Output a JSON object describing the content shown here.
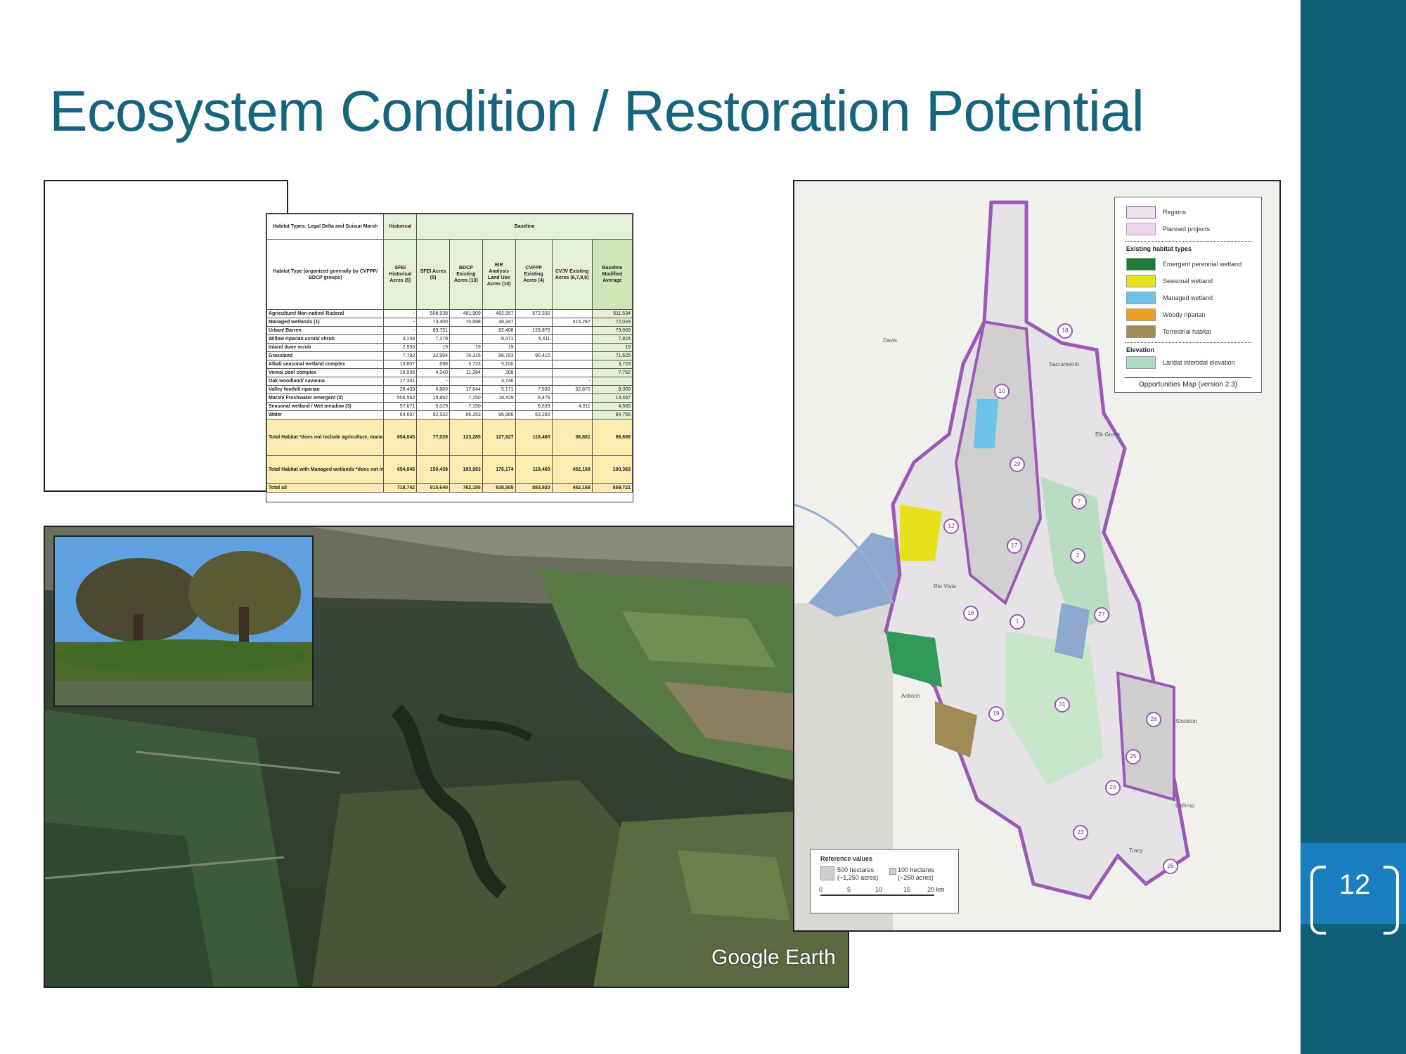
{
  "slide": {
    "title": "Ecosystem Condition / Restoration Potential",
    "page_number": "12",
    "accent_color": "#0e5f78",
    "title_color": "#16657f"
  },
  "habitat_table": {
    "title": "Habitat Types: Legal Delta and Suisun Marsh",
    "group_historical": "Historical",
    "group_baseline": "Baseline",
    "columns": [
      "Habitat Type (organized generally by CVFPP/ BDCP groups)",
      "SFEI Historical Acres (5)",
      "SFEI Acres (5)",
      "BDCP Existing Acres (13)",
      "EIR Analysis Land Use Acres (10)",
      "CVFPP Existing Acres (4)",
      "CVJV Existing Acres (6,7,8,9)",
      "Baseline Modified Average"
    ],
    "rows": [
      [
        "Agriculture/ Non-native/ Ruderal",
        "-",
        "508,938",
        "481,909",
        "482,957",
        "572,330",
        "",
        "511,534"
      ],
      [
        "Managed wetlands (1)",
        "-",
        "73,400",
        "70,698",
        "48,347",
        "",
        "415,287",
        "72,049"
      ],
      [
        "Urban/ Barren",
        "-",
        "63,731",
        "",
        "82,408",
        "129,870",
        "",
        "73,069"
      ],
      [
        "Willow riparian scrub/ shrub",
        "3,158",
        "7,278",
        "",
        "8,371",
        "5,411",
        "",
        "7,824"
      ],
      [
        "Inland dune scrub",
        "2,550",
        "19",
        "19",
        "19",
        "",
        "",
        "19"
      ],
      [
        "Grassland",
        "7,792",
        "32,994",
        "76,315",
        "86,783",
        "90,410",
        "",
        "71,625"
      ],
      [
        "Alkali seasonal wetland complex",
        "13,607",
        "698",
        "3,723",
        "5,100",
        "",
        "",
        "3,723"
      ],
      [
        "Vernal pool complex",
        "16,935",
        "4,240",
        "11,284",
        "208",
        "",
        "",
        "7,762"
      ],
      [
        "Oak woodland/ savanna",
        "17,331",
        "-",
        "",
        "3,746",
        "",
        "-",
        ""
      ],
      [
        "Valley foothill riparian",
        "28,439",
        "6,889",
        "17,644",
        "5,171",
        "7,530",
        "32,870",
        "9,309"
      ],
      [
        "Marsh/ Freshwater emergent (2)",
        "506,562",
        "19,892",
        "7,150",
        "18,429",
        "8,476",
        "",
        "13,487"
      ],
      [
        "Seasonal wetland / Wet meadow (3)",
        "57,671",
        "5,029",
        "7,150",
        "-",
        "6,633",
        "4,011",
        "4,565"
      ],
      [
        "Water",
        "64,697",
        "92,532",
        "86,263",
        "96,966",
        "63,260",
        "",
        "84,755"
      ]
    ],
    "total_habitat": [
      "Total Habitat *does not include agriculture, managed wetlands, urban/barren, water",
      "654,045",
      "77,039",
      "123,285",
      "127,827",
      "118,460",
      "36,881",
      "96,698"
    ],
    "total_with_managed": [
      "Total Habitat with Managed wetlands *does not include agriculture, urban/barren, water",
      "654,045",
      "150,439",
      "193,983",
      "176,174",
      "118,460",
      "452,168",
      "190,363"
    ],
    "total_all": [
      "Total all",
      "718,742",
      "815,640",
      "762,155",
      "838,505",
      "883,920",
      "452,168",
      "859,721"
    ]
  },
  "aerial": {
    "watermark": "Google Earth"
  },
  "map": {
    "legend": {
      "items": [
        {
          "label": "Regions",
          "color": "#e8e2ea"
        },
        {
          "label": "Planned projects",
          "color": "#edd3ec"
        }
      ],
      "habitat_header": "Existing habitat types",
      "habitats": [
        {
          "label": "Emergent perennial wetland",
          "color": "#1f7a3a"
        },
        {
          "label": "Seasonal wetland",
          "color": "#e8e21a"
        },
        {
          "label": "Managed wetland",
          "color": "#6cc2e8"
        },
        {
          "label": "Woody riparian",
          "color": "#f0a020"
        },
        {
          "label": "Terrestrial habitat",
          "color": "#a08a55"
        }
      ],
      "elevation_header": "Elevation",
      "elevation_label": "Landat intertidal elevation",
      "elevation_color": "#a9dcc0",
      "footer": "Opportunities Map (version 2.3)"
    },
    "place_labels": [
      "Davis",
      "Sacramento",
      "Elk Grove",
      "Rio Vista",
      "Antioch",
      "Stockton",
      "Lathrop",
      "Tracy"
    ],
    "region_numbers": [
      "18",
      "10",
      "29",
      "7",
      "12",
      "17",
      "2",
      "16",
      "1",
      "27",
      "31",
      "19",
      "28",
      "25",
      "24",
      "23",
      "26"
    ],
    "scale": {
      "title": "Reference values",
      "ref1": "500 hectares (~1,250 acres)",
      "ref2": "100 hectares (~250 acres)",
      "ticks": [
        "0",
        "5",
        "10",
        "15",
        "20 km"
      ]
    }
  }
}
